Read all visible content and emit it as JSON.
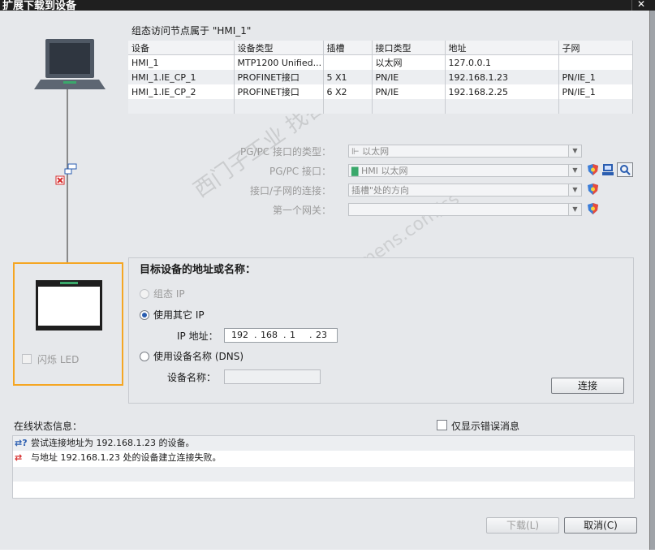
{
  "window": {
    "title": "扩展下载到设备",
    "close": "✕"
  },
  "node_label": "组态访问节点属于 \"HMI_1\"",
  "device_table": {
    "columns": [
      "设备",
      "设备类型",
      "插槽",
      "接口类型",
      "地址",
      "子网"
    ],
    "rows": [
      [
        "HMI_1",
        "MTP1200 Unified...",
        "",
        "以太网",
        "127.0.0.1",
        ""
      ],
      [
        "HMI_1.IE_CP_1",
        "PROFINET接口",
        "5 X1",
        "PN/IE",
        "192.168.1.23",
        "PN/IE_1"
      ],
      [
        "HMI_1.IE_CP_2",
        "PROFINET接口",
        "6 X2",
        "PN/IE",
        "192.168.2.25",
        "PN/IE_1"
      ],
      [
        "",
        "",
        "",
        "",
        "",
        ""
      ]
    ]
  },
  "form": {
    "pgpc_type_label": "PG/PC 接口的类型：",
    "pgpc_type_value": "以太网",
    "pgpc_if_label": "PG/PC 接口：",
    "pgpc_if_value": "HMI 以太网",
    "subnet_conn_label": "接口/子网的连接：",
    "subnet_conn_value": "插槽\"处的方向",
    "gateway_label": "第一个网关：",
    "gateway_value": ""
  },
  "target": {
    "title": "目标设备的地址或名称：",
    "opt_config_ip": "组态 IP",
    "opt_other_ip": "使用其它 IP",
    "ip_label": "IP 地址：",
    "ip": [
      "192",
      "168",
      "1",
      "23"
    ],
    "opt_dns": "使用设备名称 (DNS)",
    "devname_label": "设备名称：",
    "devname_value": "",
    "connect_button": "连接"
  },
  "flash_led": "闪烁 LED",
  "status": {
    "label": "在线状态信息：",
    "only_errors": "仅显示错误消息",
    "messages": [
      "尝试连接地址为 192.168.1.23 的设备。",
      "与地址 192.168.1.23 处的设备建立连接失败。"
    ]
  },
  "buttons": {
    "download": "下载(L)",
    "cancel": "取消(C)"
  },
  "watermark": {
    "line1": "西门子工业 找答案",
    "line2": "support.industry.siemens.com/cs"
  },
  "colors": {
    "accent": "#f5a623",
    "titlebar": "#1f1f1f",
    "radio": "#2a5db0",
    "error": "#d62b2b"
  }
}
